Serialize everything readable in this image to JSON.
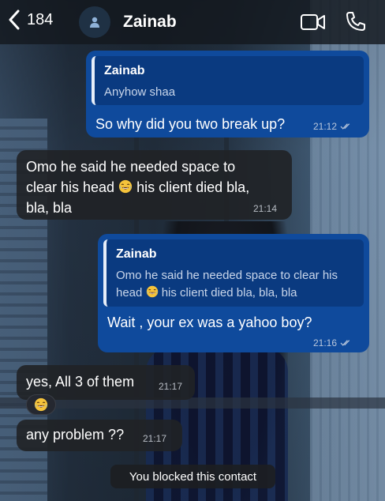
{
  "header": {
    "back_count": "184",
    "contact_name": "Zainab"
  },
  "messages": [
    {
      "direction": "outgoing",
      "quote": {
        "name": "Zainab",
        "text": "Anyhow shaa"
      },
      "text": "So why did you two break up?",
      "time": "21:12",
      "status": "read"
    },
    {
      "direction": "incoming",
      "lines": [
        "Omo he said he needed space to",
        "clear his head",
        "his client died bla,",
        "bla, bla"
      ],
      "time": "21:14"
    },
    {
      "direction": "outgoing",
      "quote": {
        "name": "Zainab",
        "line1": "Omo he said he needed space to clear his",
        "line2a": "head",
        "line2b": "his client died bla, bla, bla"
      },
      "text": "Wait , your ex was a yahoo boy?",
      "time": "21:16",
      "status": "read"
    },
    {
      "direction": "incoming",
      "text": "yes, All 3 of them",
      "time": "21:17",
      "reaction": "laughing-emoji"
    },
    {
      "direction": "incoming",
      "text": "any problem ??",
      "time": "21:17"
    }
  ],
  "system_note": "You blocked this contact",
  "colors": {
    "outgoing_bubble": "#0f4a9c",
    "incoming_bubble": "#202226",
    "header_bg": "#14181e"
  }
}
